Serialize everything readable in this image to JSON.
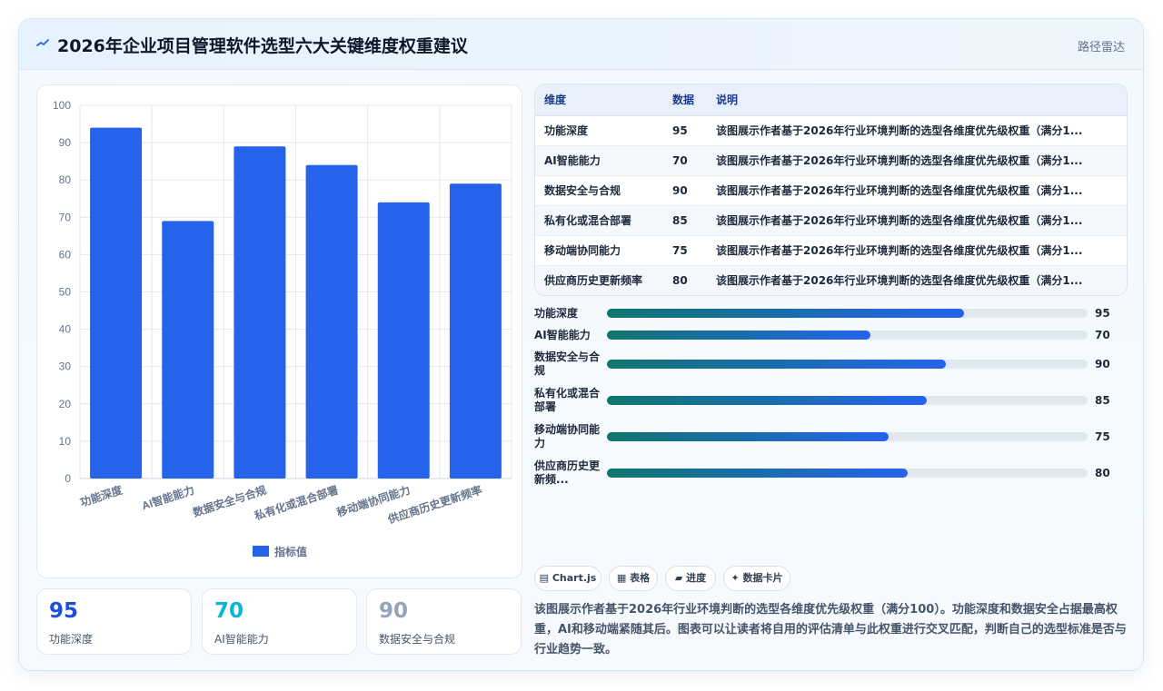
{
  "header": {
    "title": "2026年企业项目管理软件选型六大关键维度权重建议",
    "tag": "路径雷达"
  },
  "colors": {
    "bar": "#2563eb",
    "accent_green": "#0f766e",
    "stat_blue": "#1d4ed8",
    "stat_cyan": "#06b6d4",
    "stat_gray": "#94a3b8"
  },
  "chart_data": {
    "type": "bar",
    "categories": [
      "功能深度",
      "AI智能能力",
      "数据安全与合规",
      "私有化或混合部署",
      "移动端协同能力",
      "供应商历史更新频率"
    ],
    "series": [
      {
        "name": "指标值",
        "values": [
          94,
          69,
          89,
          84,
          74,
          79
        ]
      }
    ],
    "ylim": [
      0,
      100
    ],
    "yticks": [
      0,
      10,
      20,
      30,
      40,
      50,
      60,
      70,
      80,
      90,
      100
    ],
    "grid": true,
    "legend": "bottom"
  },
  "stats": [
    {
      "value": "95",
      "label": "功能深度"
    },
    {
      "value": "70",
      "label": "AI智能能力"
    },
    {
      "value": "90",
      "label": "数据安全与合规"
    }
  ],
  "table": {
    "headers": [
      "维度",
      "数据",
      "说明"
    ],
    "rows": [
      [
        "功能深度",
        "95",
        "该图展示作者基于2026年行业环境判断的选型各维度优先级权重（满分1..."
      ],
      [
        "AI智能能力",
        "70",
        "该图展示作者基于2026年行业环境判断的选型各维度优先级权重（满分1..."
      ],
      [
        "数据安全与合规",
        "90",
        "该图展示作者基于2026年行业环境判断的选型各维度优先级权重（满分1..."
      ],
      [
        "私有化或混合部署",
        "85",
        "该图展示作者基于2026年行业环境判断的选型各维度优先级权重（满分1..."
      ],
      [
        "移动端协同能力",
        "75",
        "该图展示作者基于2026年行业环境判断的选型各维度优先级权重（满分1..."
      ],
      [
        "供应商历史更新频率",
        "80",
        "该图展示作者基于2026年行业环境判断的选型各维度优先级权重（满分1..."
      ]
    ]
  },
  "progress": [
    {
      "label": "功能深度",
      "value": 95
    },
    {
      "label": "AI智能能力",
      "value": 70
    },
    {
      "label": "数据安全与合规",
      "value": 90
    },
    {
      "label": "私有化或混合部署",
      "value": 85
    },
    {
      "label": "移动端协同能力",
      "value": 75
    },
    {
      "label": "供应商历史更新频...",
      "value": 80
    }
  ],
  "progress_fill_percent": [
    74.3,
    54.8,
    70.5,
    66.5,
    58.6,
    62.6
  ],
  "chips": [
    "▤ Chart.js",
    "▦ 表格",
    "▰ 进度",
    "✦ 数据卡片"
  ],
  "description": "该图展示作者基于2026年行业环境判断的选型各维度优先级权重（满分100）。功能深度和数据安全占据最高权重，AI和移动端紧随其后。图表可以让读者将自用的评估清单与此权重进行交叉匹配，判断自己的选型标准是否与行业趋势一致。"
}
